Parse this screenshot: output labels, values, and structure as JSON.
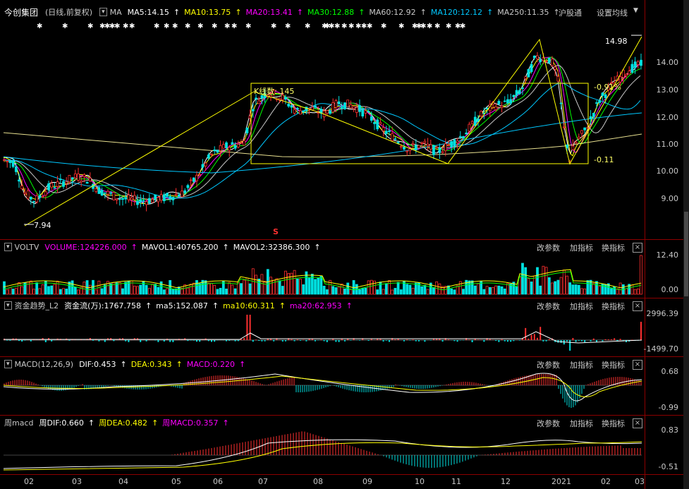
{
  "main": {
    "stock_name": "今创集团",
    "mode": "(日线,前复权)",
    "ma_label": "MA",
    "ma": [
      {
        "label": "MA5:14.15",
        "color": "#ffffff"
      },
      {
        "label": "MA10:13.75",
        "color": "#ffff00"
      },
      {
        "label": "MA20:13.41",
        "color": "#ff00ff"
      },
      {
        "label": "MA30:12.88",
        "color": "#00ff00"
      },
      {
        "label": "MA60:12.92",
        "color": "#c8c8c8"
      },
      {
        "label": "MA120:12.12",
        "color": "#00c8ff"
      },
      {
        "label": "MA250:11.35",
        "color": "#c8c8c8"
      }
    ],
    "market_tab": "沪股通",
    "set_ma": "设置均线",
    "y_ticks": [
      "14.00",
      "13.00",
      "12.00",
      "11.00",
      "10.00",
      "9.00"
    ],
    "high_label": "14.98",
    "low_label": "7.94",
    "box_label": "K线数: 145",
    "box_high_pct": "-0.91%",
    "box_low": "-0.11",
    "s_marker": "S"
  },
  "vol": {
    "title": "VOLTV",
    "fields": [
      {
        "label": "VOLUME:124226.000",
        "color": "#ff00ff"
      },
      {
        "label": "MAVOL1:40765.200",
        "color": "#ffffff"
      },
      {
        "label": "MAVOL2:32386.300",
        "color": "#ffffff"
      }
    ],
    "y_ticks": [
      "12.40",
      "0.00"
    ]
  },
  "flow": {
    "title": "资金趋势_L2",
    "fields": [
      {
        "label": "资金流(万):1767.758",
        "color": "#ffffff"
      },
      {
        "label": "ma5:152.087",
        "color": "#ffffff"
      },
      {
        "label": "ma10:60.311",
        "color": "#ffff00"
      },
      {
        "label": "ma20:62.953",
        "color": "#ff00ff"
      }
    ],
    "y_ticks": [
      "2996.39",
      "-1499.70"
    ]
  },
  "macd": {
    "title": "MACD(12,26,9)",
    "fields": [
      {
        "label": "DIF:0.453",
        "color": "#ffffff"
      },
      {
        "label": "DEA:0.343",
        "color": "#ffff00"
      },
      {
        "label": "MACD:0.220",
        "color": "#ff00ff"
      }
    ],
    "y_ticks": [
      "0.68",
      "-0.99"
    ]
  },
  "wmacd": {
    "title": "周macd",
    "fields": [
      {
        "label": "周DIF:0.660",
        "color": "#ffffff"
      },
      {
        "label": "周DEA:0.482",
        "color": "#ffff00"
      },
      {
        "label": "周MACD:0.357",
        "color": "#ff00ff"
      }
    ],
    "y_ticks": [
      "0.83",
      "-0.51"
    ]
  },
  "buttons": {
    "change_params": "改参数",
    "add_indicator": "加指标",
    "switch_indicator": "换指标",
    "close": "×"
  },
  "x_dates": [
    "02",
    "03",
    "04",
    "05",
    "06",
    "07",
    "08",
    "09",
    "10",
    "11",
    "12",
    "2021",
    "02",
    "03"
  ]
}
